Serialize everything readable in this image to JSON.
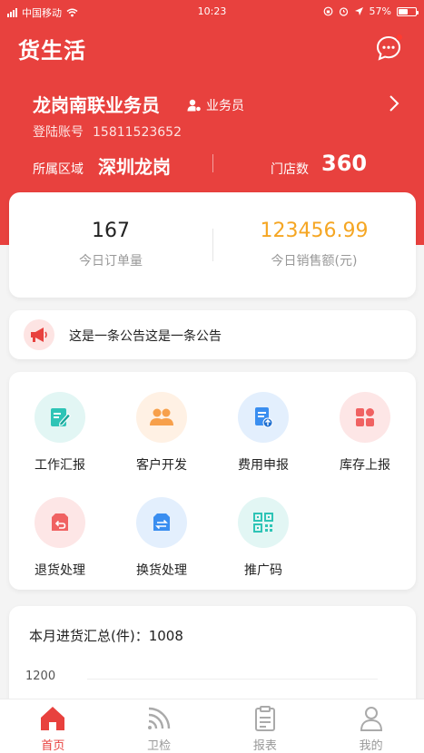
{
  "status_bar": {
    "carrier": "中国移动",
    "time": "10:23",
    "battery_percent": "57%",
    "battery_level": 0.57
  },
  "header": {
    "title": "货生活"
  },
  "profile": {
    "name": "龙岗南联业务员",
    "role": "业务员",
    "account_label": "登陆账号",
    "account_number": "15811523652",
    "region_label": "所属区域",
    "region_value": "深圳龙岗",
    "store_label": "门店数",
    "store_count": "360"
  },
  "stats": {
    "orders_value": "167",
    "orders_label": "今日订单量",
    "sales_value": "123456.99",
    "sales_label": "今日销售额(元)"
  },
  "notice": {
    "text": "这是一条公告这是一条公告"
  },
  "menu": [
    {
      "label": "工作汇报",
      "icon": "report-icon",
      "bg": "#e2f6f4",
      "color": "#2ec4b6"
    },
    {
      "label": "客户开发",
      "icon": "customers-icon",
      "bg": "#fff1e4",
      "color": "#f7a04b"
    },
    {
      "label": "费用申报",
      "icon": "expense-icon",
      "bg": "#e3effd",
      "color": "#3a8ef0"
    },
    {
      "label": "库存上报",
      "icon": "inventory-icon",
      "bg": "#fde6e6",
      "color": "#f06262"
    },
    {
      "label": "退货处理",
      "icon": "return-icon",
      "bg": "#fde6e6",
      "color": "#f06262"
    },
    {
      "label": "换货处理",
      "icon": "exchange-icon",
      "bg": "#e3effd",
      "color": "#3a8ef0"
    },
    {
      "label": "推广码",
      "icon": "qrcode-icon",
      "bg": "#e2f6f4",
      "color": "#2ec4b6"
    }
  ],
  "summary": {
    "title": "本月进货汇总(件)：1008",
    "y_tick": "1200"
  },
  "tabs": [
    {
      "label": "首页",
      "icon": "home-icon",
      "active": true
    },
    {
      "label": "卫检",
      "icon": "signal-icon",
      "active": false
    },
    {
      "label": "报表",
      "icon": "clipboard-icon",
      "active": false
    },
    {
      "label": "我的",
      "icon": "user-icon",
      "active": false
    }
  ],
  "colors": {
    "brand_red": "#e8413e",
    "sales_orange": "#f5a623",
    "inactive_gray": "#999999"
  }
}
